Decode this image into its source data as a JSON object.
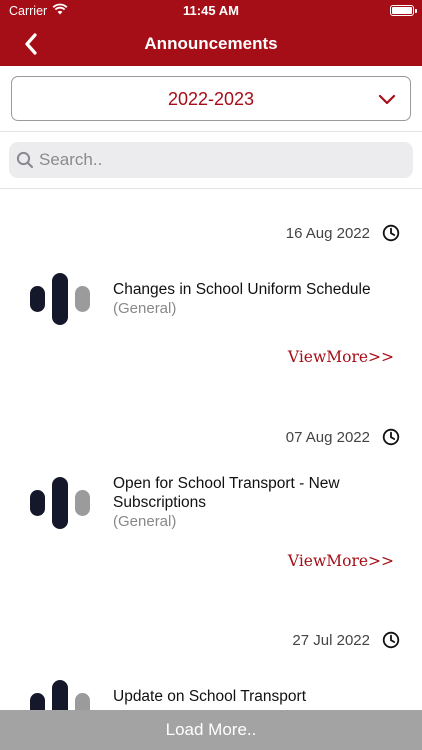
{
  "status_bar": {
    "carrier": "Carrier",
    "time": "11:45 AM"
  },
  "nav": {
    "title": "Announcements",
    "back_icon": "chevron-left-icon"
  },
  "year_select": {
    "value": "2022-2023",
    "icon": "chevron-down-icon"
  },
  "search": {
    "placeholder": "Search..",
    "value": ""
  },
  "announcements": [
    {
      "date": "16 Aug 2022",
      "title": "Changes in School Uniform Schedule",
      "category": "(General)",
      "link": "ViewMore>>"
    },
    {
      "date": "07 Aug 2022",
      "title": "Open for School Transport - New Subscriptions",
      "category": "(General)",
      "link": "ViewMore>>"
    },
    {
      "date": "27 Jul 2022",
      "title": "Update on School Transport",
      "category": "",
      "link": ""
    }
  ],
  "load_more": "Load More..",
  "colors": {
    "brand": "#a50e17",
    "load_more_bg": "#a3a3a3",
    "logo_dark": "#15182a",
    "logo_gray": "#9b9b9b"
  }
}
